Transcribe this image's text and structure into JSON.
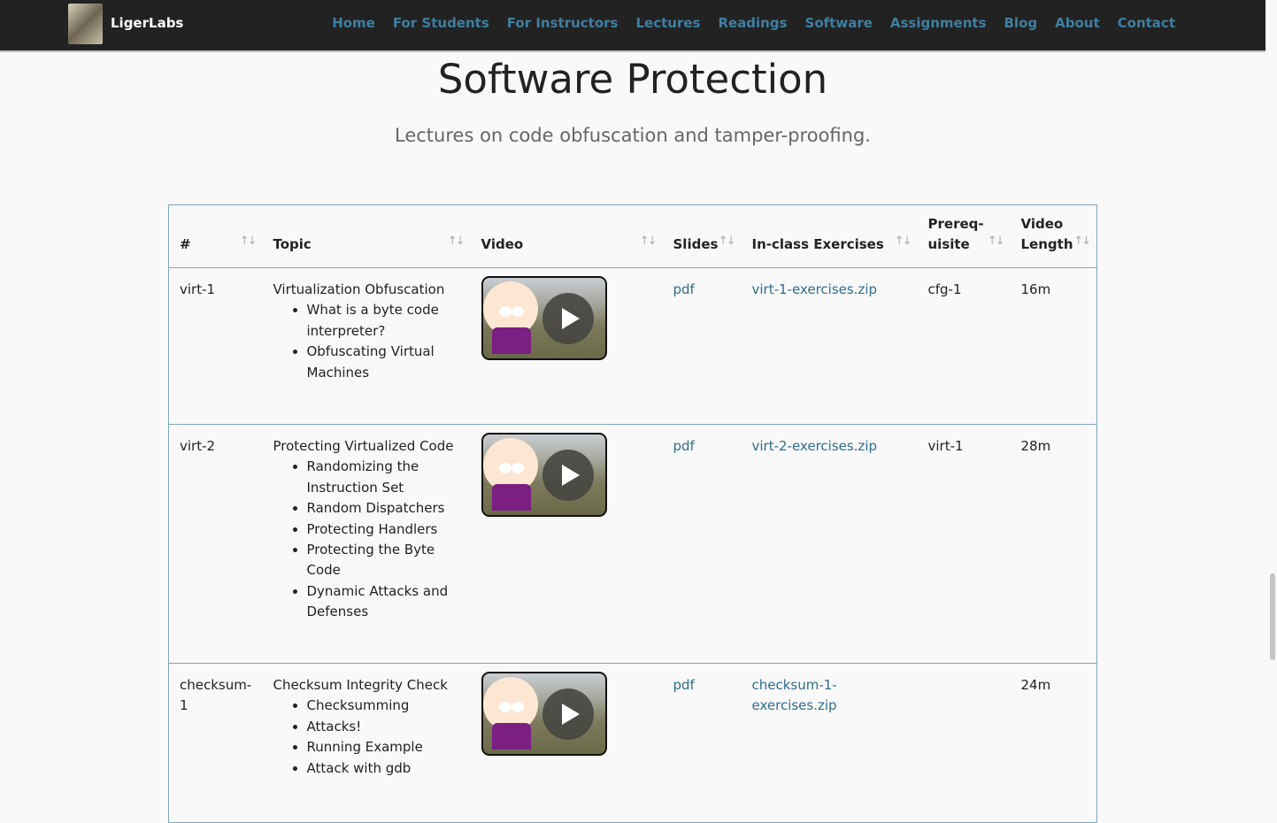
{
  "nav": {
    "brand": "LigerLabs",
    "items": [
      "Home",
      "For Students",
      "For Instructors",
      "Lectures",
      "Readings",
      "Software",
      "Assignments",
      "Blog",
      "About",
      "Contact"
    ],
    "link_color": "#3e7fa1"
  },
  "page": {
    "title": "Software Protection",
    "subtitle": "Lectures on code obfuscation and tamper-proofing."
  },
  "table": {
    "headers": [
      "#",
      "Topic",
      "Video",
      "Slides",
      "In-class Exercises",
      "Prereq-uisite",
      "Video Length"
    ],
    "sort_icon": "sort-arrows-icon",
    "rows": [
      {
        "id": "virt-1",
        "topic": "Virtualization Obfuscation",
        "subtopics": [
          "What is a byte code interpreter?",
          "Obfuscating Virtual Machines"
        ],
        "slides": "pdf",
        "exercises": "virt-1-exercises.zip",
        "prereq": "cfg-1",
        "length": "16m"
      },
      {
        "id": "virt-2",
        "topic": "Protecting Virtualized Code",
        "subtopics": [
          "Randomizing the Instruction Set",
          "Random Dispatchers",
          "Protecting Handlers",
          "Protecting the Byte Code",
          "Dynamic Attacks and Defenses"
        ],
        "slides": "pdf",
        "exercises": "virt-2-exercises.zip",
        "prereq": "virt-1",
        "length": "28m"
      },
      {
        "id": "checksum-1",
        "topic": "Checksum Integrity Check",
        "subtopics": [
          "Checksumming",
          "Attacks!",
          "Running Example",
          "Attack with gdb"
        ],
        "slides": "pdf",
        "exercises": "checksum-1-exercises.zip",
        "prereq": "",
        "length": "24m"
      }
    ]
  }
}
